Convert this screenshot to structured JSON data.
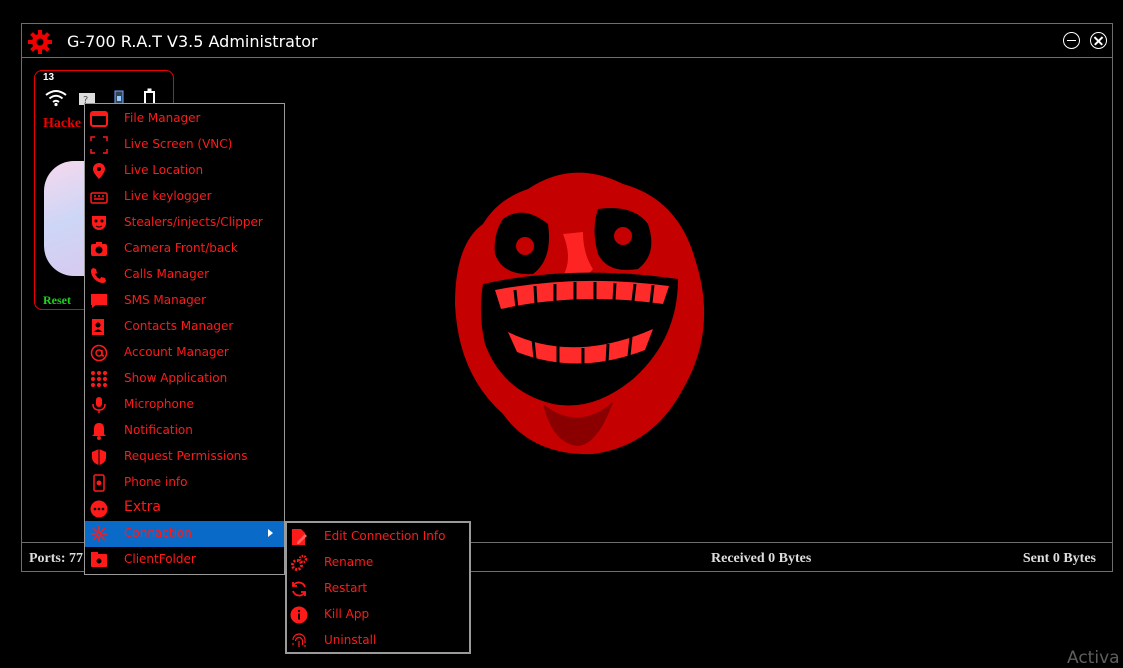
{
  "window": {
    "title": "G-700 R.A.T V3.5 Administrator"
  },
  "client_card": {
    "number": "13",
    "name": "Hacke",
    "reset_label": "Reset"
  },
  "status": {
    "ports": "Ports: 77",
    "received": "Received 0 Bytes",
    "sent": "Sent 0 Bytes"
  },
  "menu": {
    "items": [
      {
        "label": "File Manager",
        "icon": "folder-icon"
      },
      {
        "label": "Live Screen (VNC)",
        "icon": "screen-capture-icon"
      },
      {
        "label": "Live Location",
        "icon": "location-pin-icon"
      },
      {
        "label": "Live keylogger",
        "icon": "keyboard-icon"
      },
      {
        "label": "Stealers/injects/Clipper",
        "icon": "mask-icon"
      },
      {
        "label": "Camera  Front/back",
        "icon": "camera-icon"
      },
      {
        "label": "Calls Manager",
        "icon": "phone-icon"
      },
      {
        "label": "SMS Manager",
        "icon": "sms-icon"
      },
      {
        "label": "Contacts Manager",
        "icon": "contacts-icon"
      },
      {
        "label": "Account Manager",
        "icon": "at-sign-icon"
      },
      {
        "label": "Show Application",
        "icon": "app-grid-icon"
      },
      {
        "label": "Microphone",
        "icon": "microphone-icon"
      },
      {
        "label": "Notification",
        "icon": "bell-icon"
      },
      {
        "label": "Request Permissions",
        "icon": "shield-icon"
      },
      {
        "label": "Phone info",
        "icon": "phone-info-icon"
      },
      {
        "label": "Extra",
        "icon": "more-icon"
      },
      {
        "label": "Connaction",
        "icon": "network-icon"
      },
      {
        "label": "ClientFolder",
        "icon": "client-folder-icon"
      }
    ]
  },
  "submenu": {
    "items": [
      {
        "label": "Edit Connection Info",
        "icon": "edit-file-icon"
      },
      {
        "label": "Rename",
        "icon": "gears-icon"
      },
      {
        "label": "Restart",
        "icon": "restart-icon"
      },
      {
        "label": "Kill App",
        "icon": "info-icon"
      },
      {
        "label": "Uninstall",
        "icon": "fingerprint-icon"
      }
    ]
  },
  "watermark": "Activa",
  "colors": {
    "accent": "#ff1a1a",
    "selection": "#0a6ac8",
    "border": "#6e6e6e",
    "reset": "#1ed21e"
  }
}
